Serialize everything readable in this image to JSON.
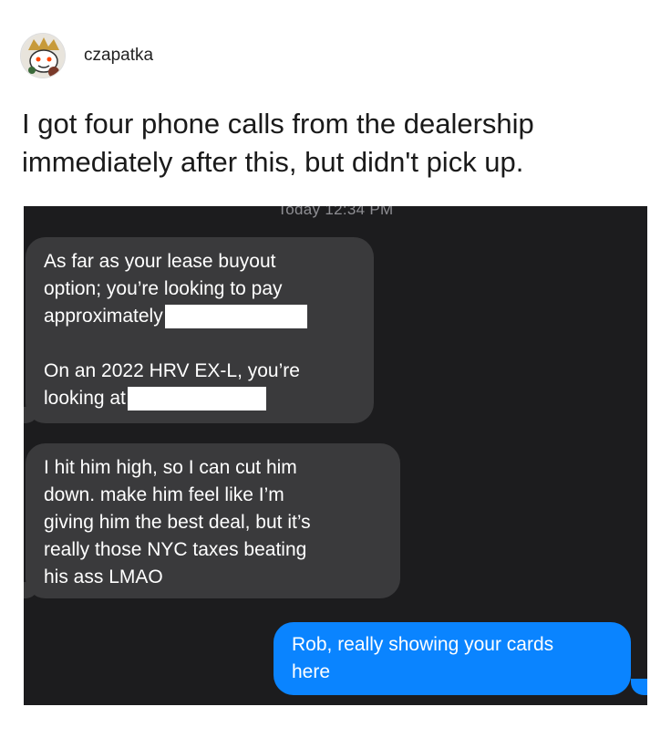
{
  "post": {
    "username": "czapatka",
    "title": "I got four phone calls from the dealership immediately after this, but didn't pick up."
  },
  "conversation": {
    "timestamp": "Today 12:34 PM",
    "messages": [
      {
        "direction": "incoming",
        "lines": [
          "As far as your lease buyout",
          "option; you’re looking to pay",
          "approximately"
        ],
        "lines2": [
          "On an 2022 HRV EX-L, you’re",
          "looking at"
        ]
      },
      {
        "direction": "incoming",
        "lines": [
          "I hit him high, so I can cut him",
          "down. make him feel like I’m",
          "giving him the best deal, but it’s",
          "really those NYC taxes beating",
          "his ass LMAO"
        ]
      },
      {
        "direction": "outgoing",
        "lines": [
          "Rob, really showing your cards",
          "here"
        ]
      }
    ]
  },
  "colors": {
    "background": "#1c1c1e",
    "incoming_bubble": "#3a3a3c",
    "outgoing_bubble": "#0a84ff"
  }
}
